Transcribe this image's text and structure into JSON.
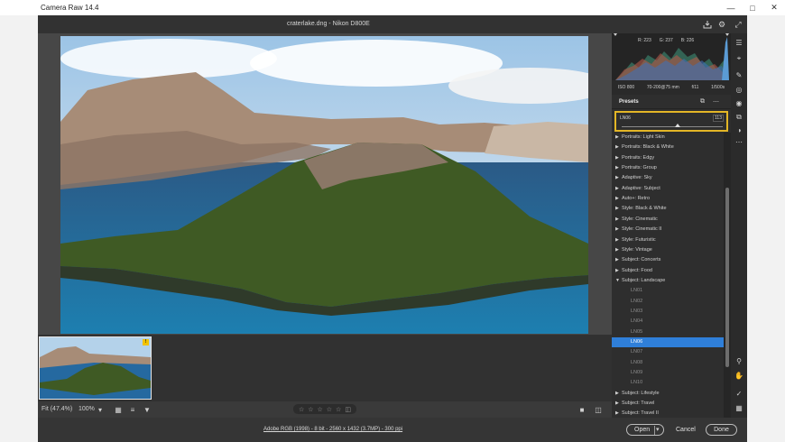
{
  "window": {
    "title": "Camera Raw 14.4"
  },
  "topbar": {
    "filename": "craterlake.dng",
    "separator": " - ",
    "camera": "Nikon D800E"
  },
  "histogram": {
    "r_label": "R: 223",
    "g_label": "G: 237",
    "b_label": "B: 226"
  },
  "exif": {
    "iso": "ISO 800",
    "lens": "70-200@75 mm",
    "aperture": "f/11",
    "shutter": "1/500s"
  },
  "presets": {
    "title": "Presets",
    "amount_name": "LN06",
    "amount_value": "113",
    "amount_fraction": 0.55,
    "groups": [
      "Portraits: Light Skin",
      "Portraits: Black & White",
      "Portraits: Edgy",
      "Portraits: Group",
      "Adaptive: Sky",
      "Adaptive: Subject",
      "Auto+: Retro",
      "Style: Black & White",
      "Style: Cinematic",
      "Style: Cinematic II",
      "Style: Futuristic",
      "Style: Vintage",
      "Subject: Concerts",
      "Subject: Food",
      "Subject: Landscape"
    ],
    "children": [
      "LN01",
      "LN02",
      "LN03",
      "LN04",
      "LN05",
      "LN06",
      "LN07",
      "LN08",
      "LN09",
      "LN10"
    ],
    "selected_child": "LN06",
    "after_groups": [
      "Subject: Lifestyle",
      "Subject: Travel",
      "Subject: Travel II"
    ]
  },
  "status": {
    "fit": "Fit (47.4%)",
    "zoom": "100%"
  },
  "workflow": "Adobe RGB (1998) - 8 bit - 2560 x 1432 (3.7MP) - 300 ppi",
  "buttons": {
    "open": "Open",
    "cancel": "Cancel",
    "done": "Done"
  },
  "colors": {
    "accent_highlight": "#e3b626",
    "selection": "#2f7fd9"
  }
}
